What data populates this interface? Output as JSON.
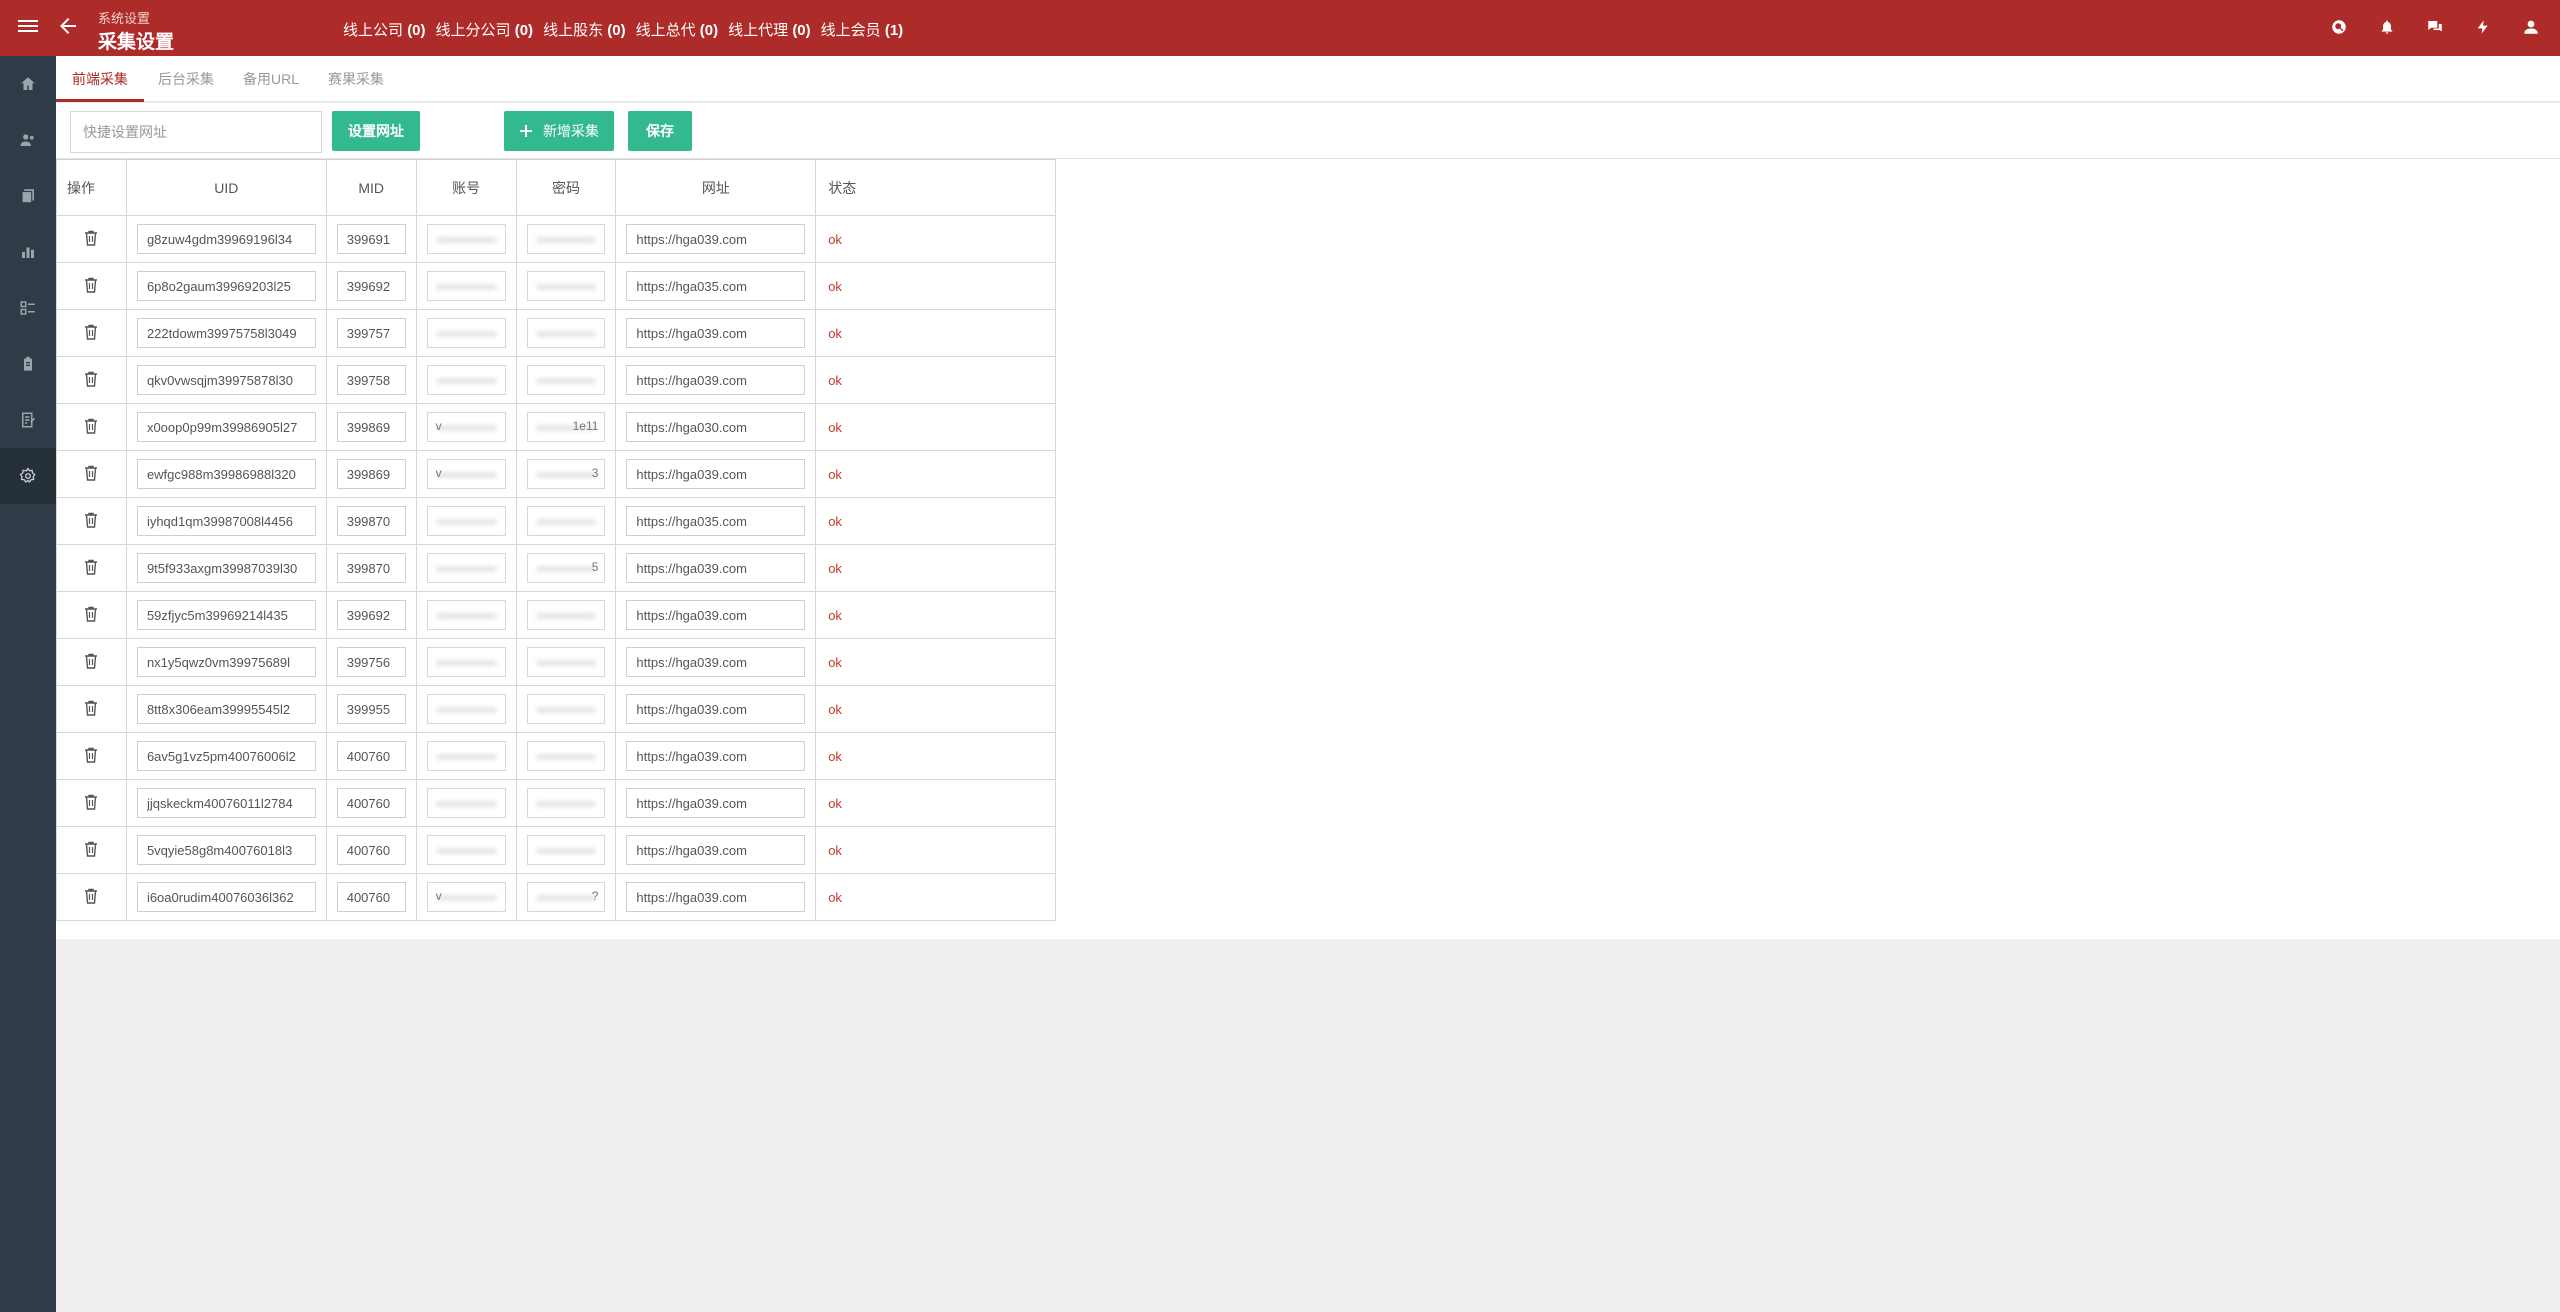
{
  "header": {
    "breadcrumb": "系统设置",
    "title": "采集设置",
    "stats": [
      {
        "label": "线上公司",
        "count": "(0)"
      },
      {
        "label": "线上分公司",
        "count": "(0)"
      },
      {
        "label": "线上股东",
        "count": "(0)"
      },
      {
        "label": "线上总代",
        "count": "(0)"
      },
      {
        "label": "线上代理",
        "count": "(0)"
      },
      {
        "label": "线上会员",
        "count": "(1)"
      }
    ],
    "icons": [
      "search-icon",
      "bell-icon",
      "chat-icon",
      "bolt-icon",
      "user-icon"
    ],
    "brand_color": "#ad2b28"
  },
  "sidebar": {
    "items": [
      "home-icon",
      "users-icon",
      "copy-icon",
      "chart-icon",
      "list-icon",
      "clipboard-icon",
      "report-icon",
      "settings-icon"
    ],
    "active": "settings-icon"
  },
  "tabs": [
    "前端采集",
    "后台采集",
    "备用URL",
    "赛果采集"
  ],
  "active_tab": "前端采集",
  "toolbar": {
    "quick_placeholder": "快捷设置网址",
    "set_url_label": "设置网址",
    "add_label": "新增采集",
    "save_label": "保存",
    "button_color": "#33b98f"
  },
  "table": {
    "headers": {
      "op": "操作",
      "uid": "UID",
      "mid": "MID",
      "account": "账号",
      "password": "密码",
      "url": "网址",
      "status": "状态"
    },
    "rows": [
      {
        "uid": "g8zuw4gdm39969196l34",
        "mid": "399691",
        "account": "",
        "password": "",
        "url": "https://hga039.com",
        "status": "ok"
      },
      {
        "uid": "6p8o2gaum39969203l25",
        "mid": "399692",
        "account": "",
        "password": "",
        "url": "https://hga035.com",
        "status": "ok"
      },
      {
        "uid": "222tdowm39975758l3049",
        "mid": "399757",
        "account": "",
        "password": "",
        "url": "https://hga039.com",
        "status": "ok"
      },
      {
        "uid": "qkv0vwsqjm39975878l30",
        "mid": "399758",
        "account": "",
        "password": "",
        "url": "https://hga039.com",
        "status": "ok"
      },
      {
        "uid": "x0oop0p99m39986905l27",
        "mid": "399869",
        "account": "v",
        "password": "1e11",
        "url": "https://hga030.com",
        "status": "ok"
      },
      {
        "uid": "ewfgc988m39986988l320",
        "mid": "399869",
        "account": "v",
        "password": "3",
        "url": "https://hga039.com",
        "status": "ok"
      },
      {
        "uid": "iyhqd1qm39987008l4456",
        "mid": "399870",
        "account": "",
        "password": "",
        "url": "https://hga035.com",
        "status": "ok"
      },
      {
        "uid": "9t5f933axgm39987039l30",
        "mid": "399870",
        "account": "",
        "password": "5",
        "url": "https://hga039.com",
        "status": "ok"
      },
      {
        "uid": "59zfjyc5m39969214l435",
        "mid": "399692",
        "account": "",
        "password": "",
        "url": "https://hga039.com",
        "status": "ok"
      },
      {
        "uid": "nx1y5qwz0vm39975689l",
        "mid": "399756",
        "account": "",
        "password": "",
        "url": "https://hga039.com",
        "status": "ok"
      },
      {
        "uid": "8tt8x306eam39995545l2",
        "mid": "399955",
        "account": "",
        "password": "",
        "url": "https://hga039.com",
        "status": "ok"
      },
      {
        "uid": "6av5g1vz5pm40076006l2",
        "mid": "400760",
        "account": "",
        "password": "",
        "url": "https://hga039.com",
        "status": "ok"
      },
      {
        "uid": "jjqskeckm40076011l2784",
        "mid": "400760",
        "account": "",
        "password": "",
        "url": "https://hga039.com",
        "status": "ok"
      },
      {
        "uid": "5vqyie58g8m40076018l3",
        "mid": "400760",
        "account": "",
        "password": "",
        "url": "https://hga039.com",
        "status": "ok"
      },
      {
        "uid": "i6oa0rudim40076036l362",
        "mid": "400760",
        "account": "v",
        "password": "?",
        "url": "https://hga039.com",
        "status": "ok"
      }
    ]
  }
}
